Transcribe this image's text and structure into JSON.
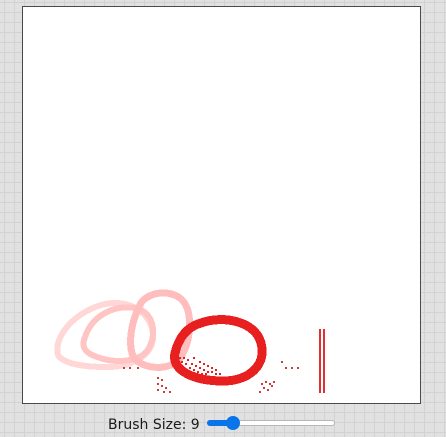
{
  "canvas": {
    "stroke_color": "#e81f1f",
    "faded_stroke_color": "#ffc8c8"
  },
  "controls": {
    "brush_label": "Brush Size: 9",
    "brush_size": 9,
    "slider_min": 1,
    "slider_max": 50,
    "accent_color": "#0a75e8"
  }
}
